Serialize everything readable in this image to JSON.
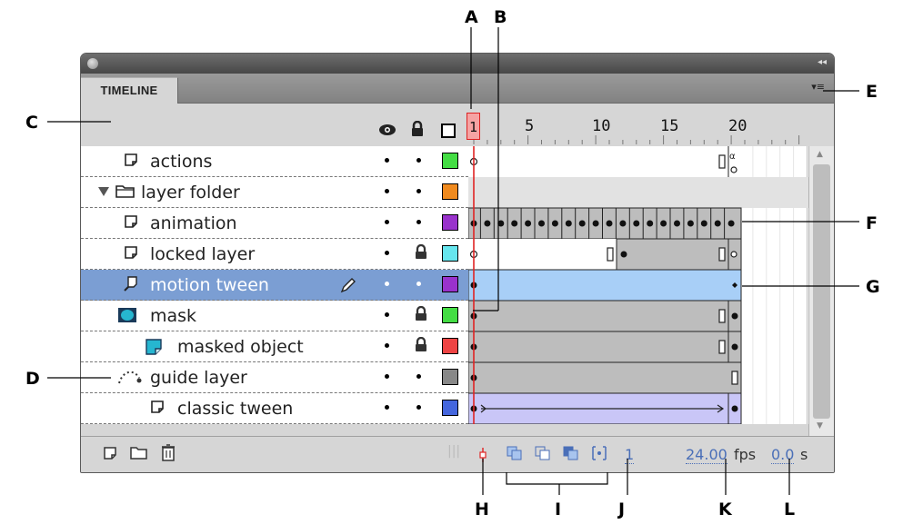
{
  "panel": {
    "tab_label": "TIMELINE",
    "collapse_glyph": "◂◂",
    "menu_glyph": "▾≡"
  },
  "columns": {
    "eye_icon": "eye-icon",
    "lock_icon": "lock-icon",
    "outline_icon": "outline-icon"
  },
  "ruler": {
    "current_frame": "1",
    "labels": [
      "5",
      "10",
      "15",
      "20"
    ]
  },
  "layers": [
    {
      "name": "actions",
      "icon": "layer-icon",
      "locked": false,
      "color": "#44dd44"
    },
    {
      "name": "layer folder",
      "icon": "folder-icon",
      "locked": false,
      "color": "#f08a1e"
    },
    {
      "name": "animation",
      "icon": "layer-icon",
      "locked": false,
      "color": "#9932cc"
    },
    {
      "name": "locked layer",
      "icon": "layer-icon",
      "locked": true,
      "color": "#66e6ee"
    },
    {
      "name": "motion tween",
      "icon": "motion-tween-icon",
      "locked": false,
      "color": "#9932cc",
      "selected": true
    },
    {
      "name": "mask",
      "icon": "mask-icon",
      "locked": true,
      "color": "#44dd44"
    },
    {
      "name": "masked object",
      "icon": "masked-icon",
      "locked": true,
      "color": "#ee4444"
    },
    {
      "name": "guide layer",
      "icon": "guide-icon",
      "locked": false,
      "color": "#888888"
    },
    {
      "name": "classic tween",
      "icon": "layer-icon",
      "locked": false,
      "color": "#4466dd"
    }
  ],
  "bottom": {
    "current_frame": "1",
    "fps_value": "24.00",
    "fps_unit": "fps",
    "time_value": "0.0",
    "time_unit": "s"
  },
  "callouts": [
    "A",
    "B",
    "C",
    "D",
    "E",
    "F",
    "G",
    "H",
    "I",
    "J",
    "K",
    "L"
  ]
}
